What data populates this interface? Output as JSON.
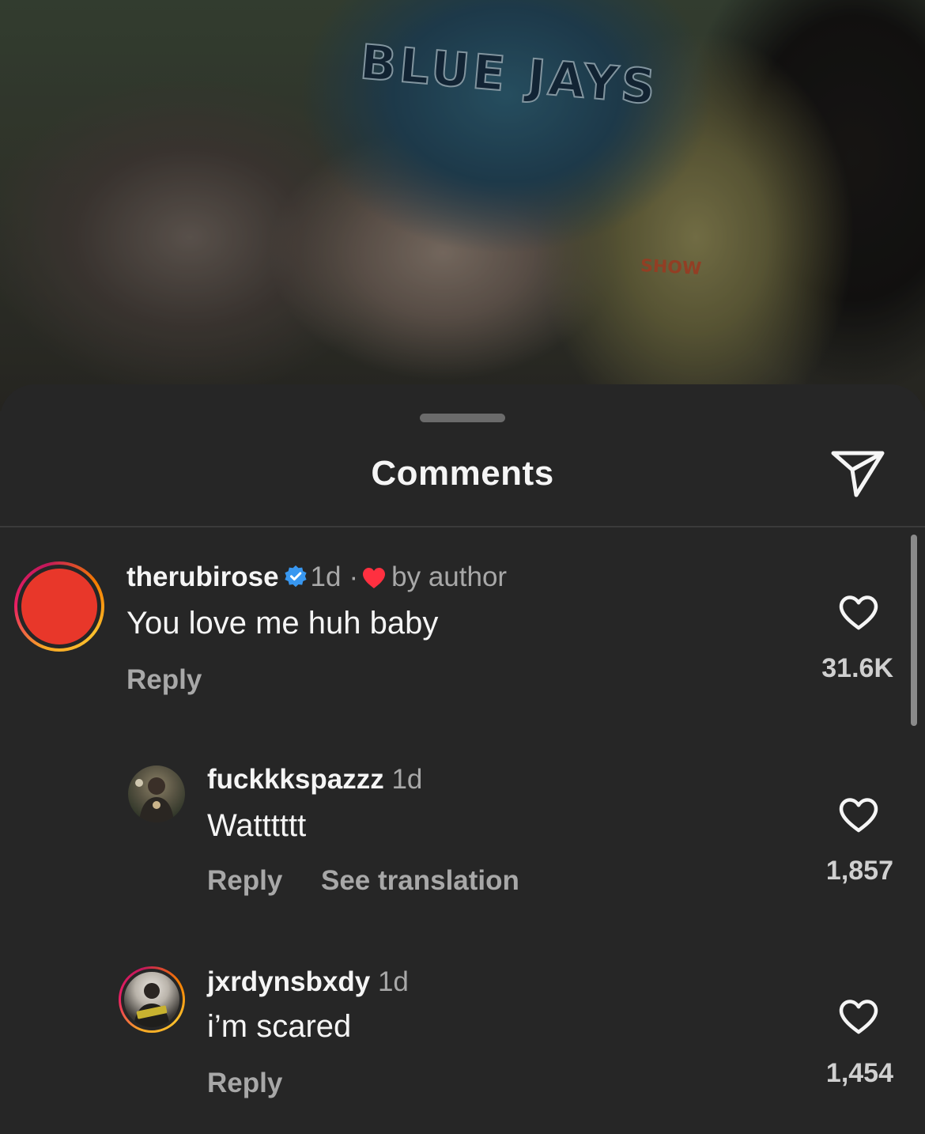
{
  "post": {
    "jersey_text": "BLUE JAYS",
    "shirt_text": "SHOW"
  },
  "sheet": {
    "title": "Comments",
    "share_icon": "paper-plane-icon"
  },
  "comments": [
    {
      "username": "therubirose",
      "verified": true,
      "time": "1d",
      "separator": "·",
      "liked_by_author": "by author",
      "text": "You love me huh baby",
      "reply_label": "Reply",
      "like_count": "31.6K",
      "avatar_color": "#e8372a"
    },
    {
      "username": "fuckkkspazzz",
      "time": "1d",
      "text": "Watttttt",
      "reply_label": "Reply",
      "translation_label": "See translation",
      "like_count": "1,857"
    },
    {
      "username": "jxrdynsbxdy",
      "time": "1d",
      "text": "i’m scared",
      "reply_label": "Reply",
      "like_count": "1,454"
    }
  ],
  "colors": {
    "sheet_bg": "#262626",
    "primary_text": "#f5f5f5",
    "secondary_text": "#a8a8a8",
    "verified_blue": "#3897f0",
    "author_heart": "#ff3040"
  }
}
